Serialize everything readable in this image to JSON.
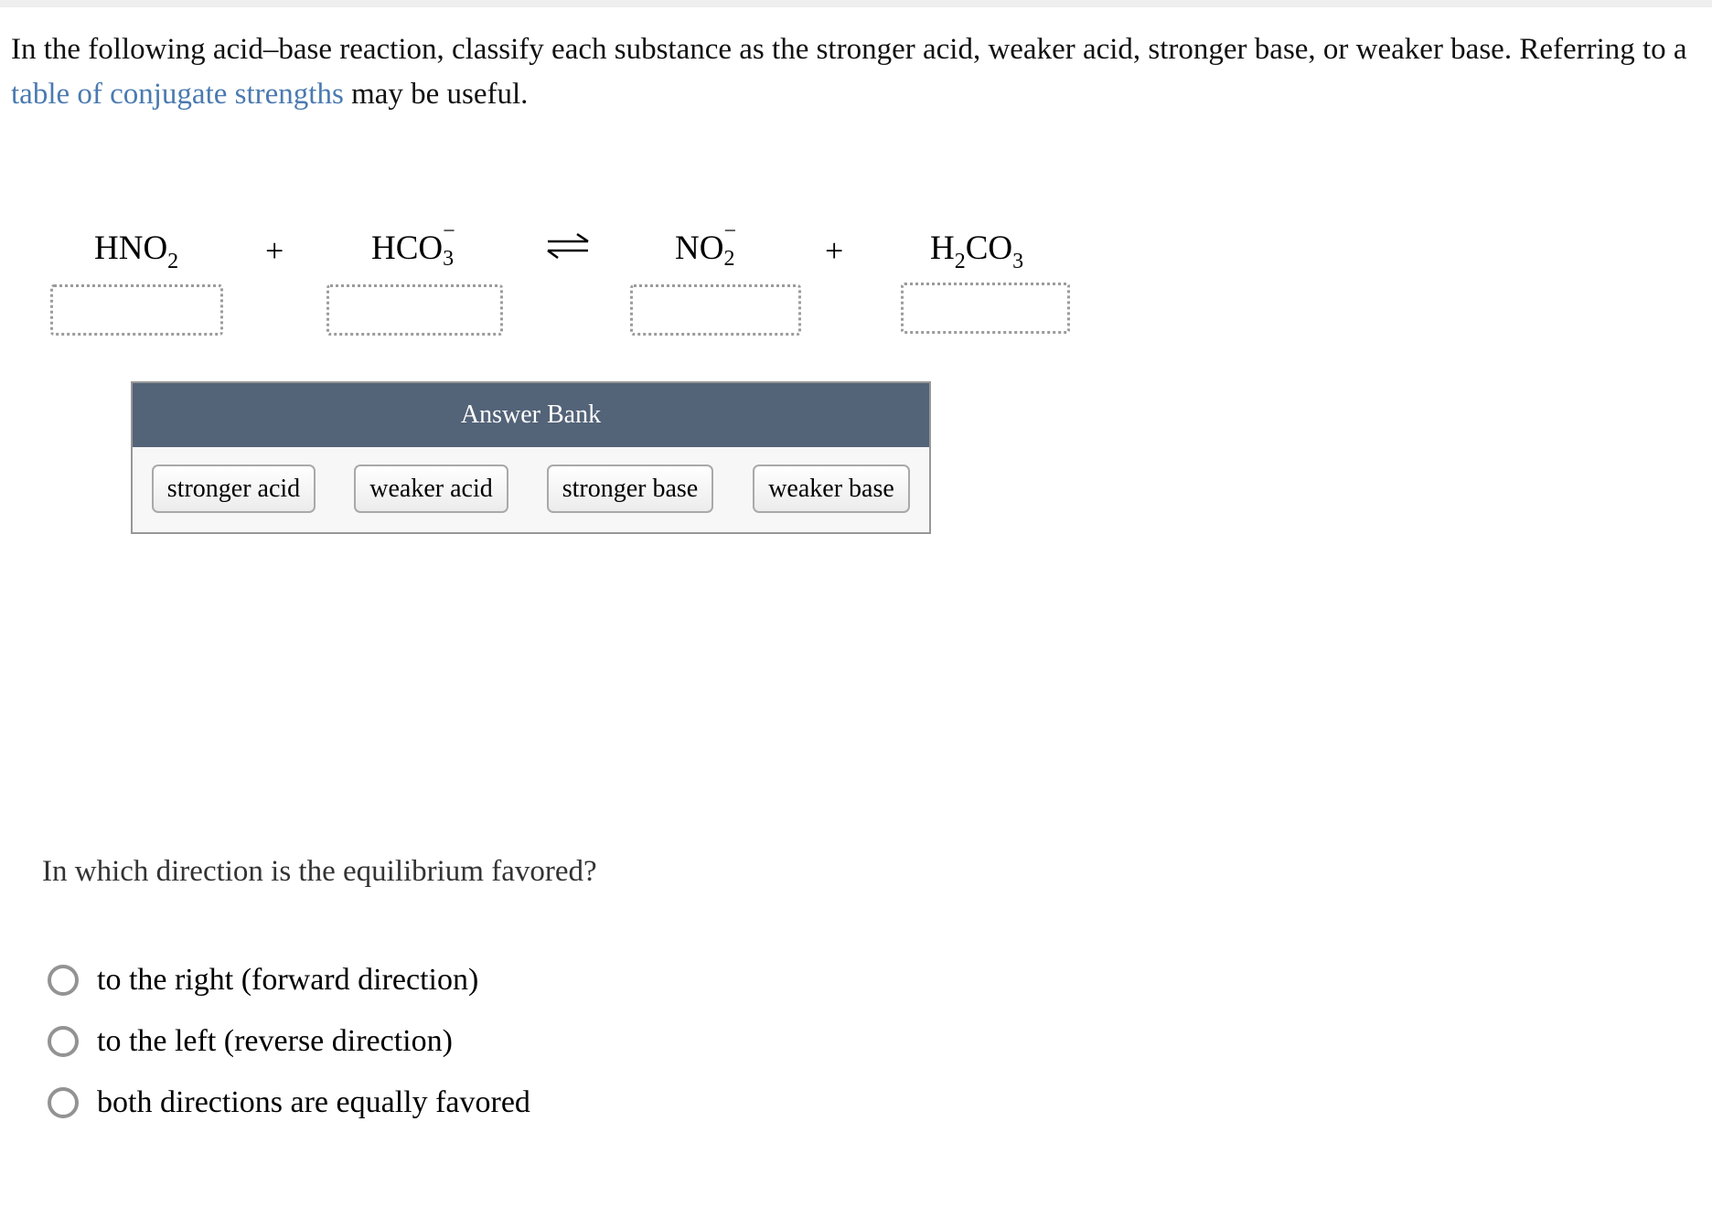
{
  "instructions": {
    "text_before_link": "In the following acid–base reaction, classify each substance as the stronger acid, weaker acid, stronger base, or weaker base. Referring to a ",
    "link_text": "table of conjugate strengths",
    "text_after_link": " may be useful."
  },
  "equation": {
    "reactant1": {
      "main": "HNO",
      "sub": "2"
    },
    "plus1": "+",
    "reactant2": {
      "main": "HCO",
      "sub": "3",
      "sup": "−"
    },
    "arrow": "equilibrium-arrow",
    "product1": {
      "main": "NO",
      "sub": "2",
      "sup": "−"
    },
    "plus2": "+",
    "product2": {
      "h": "H",
      "hsub": "2",
      "main": "CO",
      "sub": "3"
    }
  },
  "answer_bank": {
    "title": "Answer Bank",
    "chips": [
      "stronger acid",
      "weaker acid",
      "stronger base",
      "weaker base"
    ]
  },
  "question": "In which direction is the equilibrium favored?",
  "options": [
    "to the right (forward direction)",
    "to the left (reverse direction)",
    "both directions are equally favored"
  ],
  "colors": {
    "link": "#4a7ab0",
    "bank_header": "#536378"
  }
}
